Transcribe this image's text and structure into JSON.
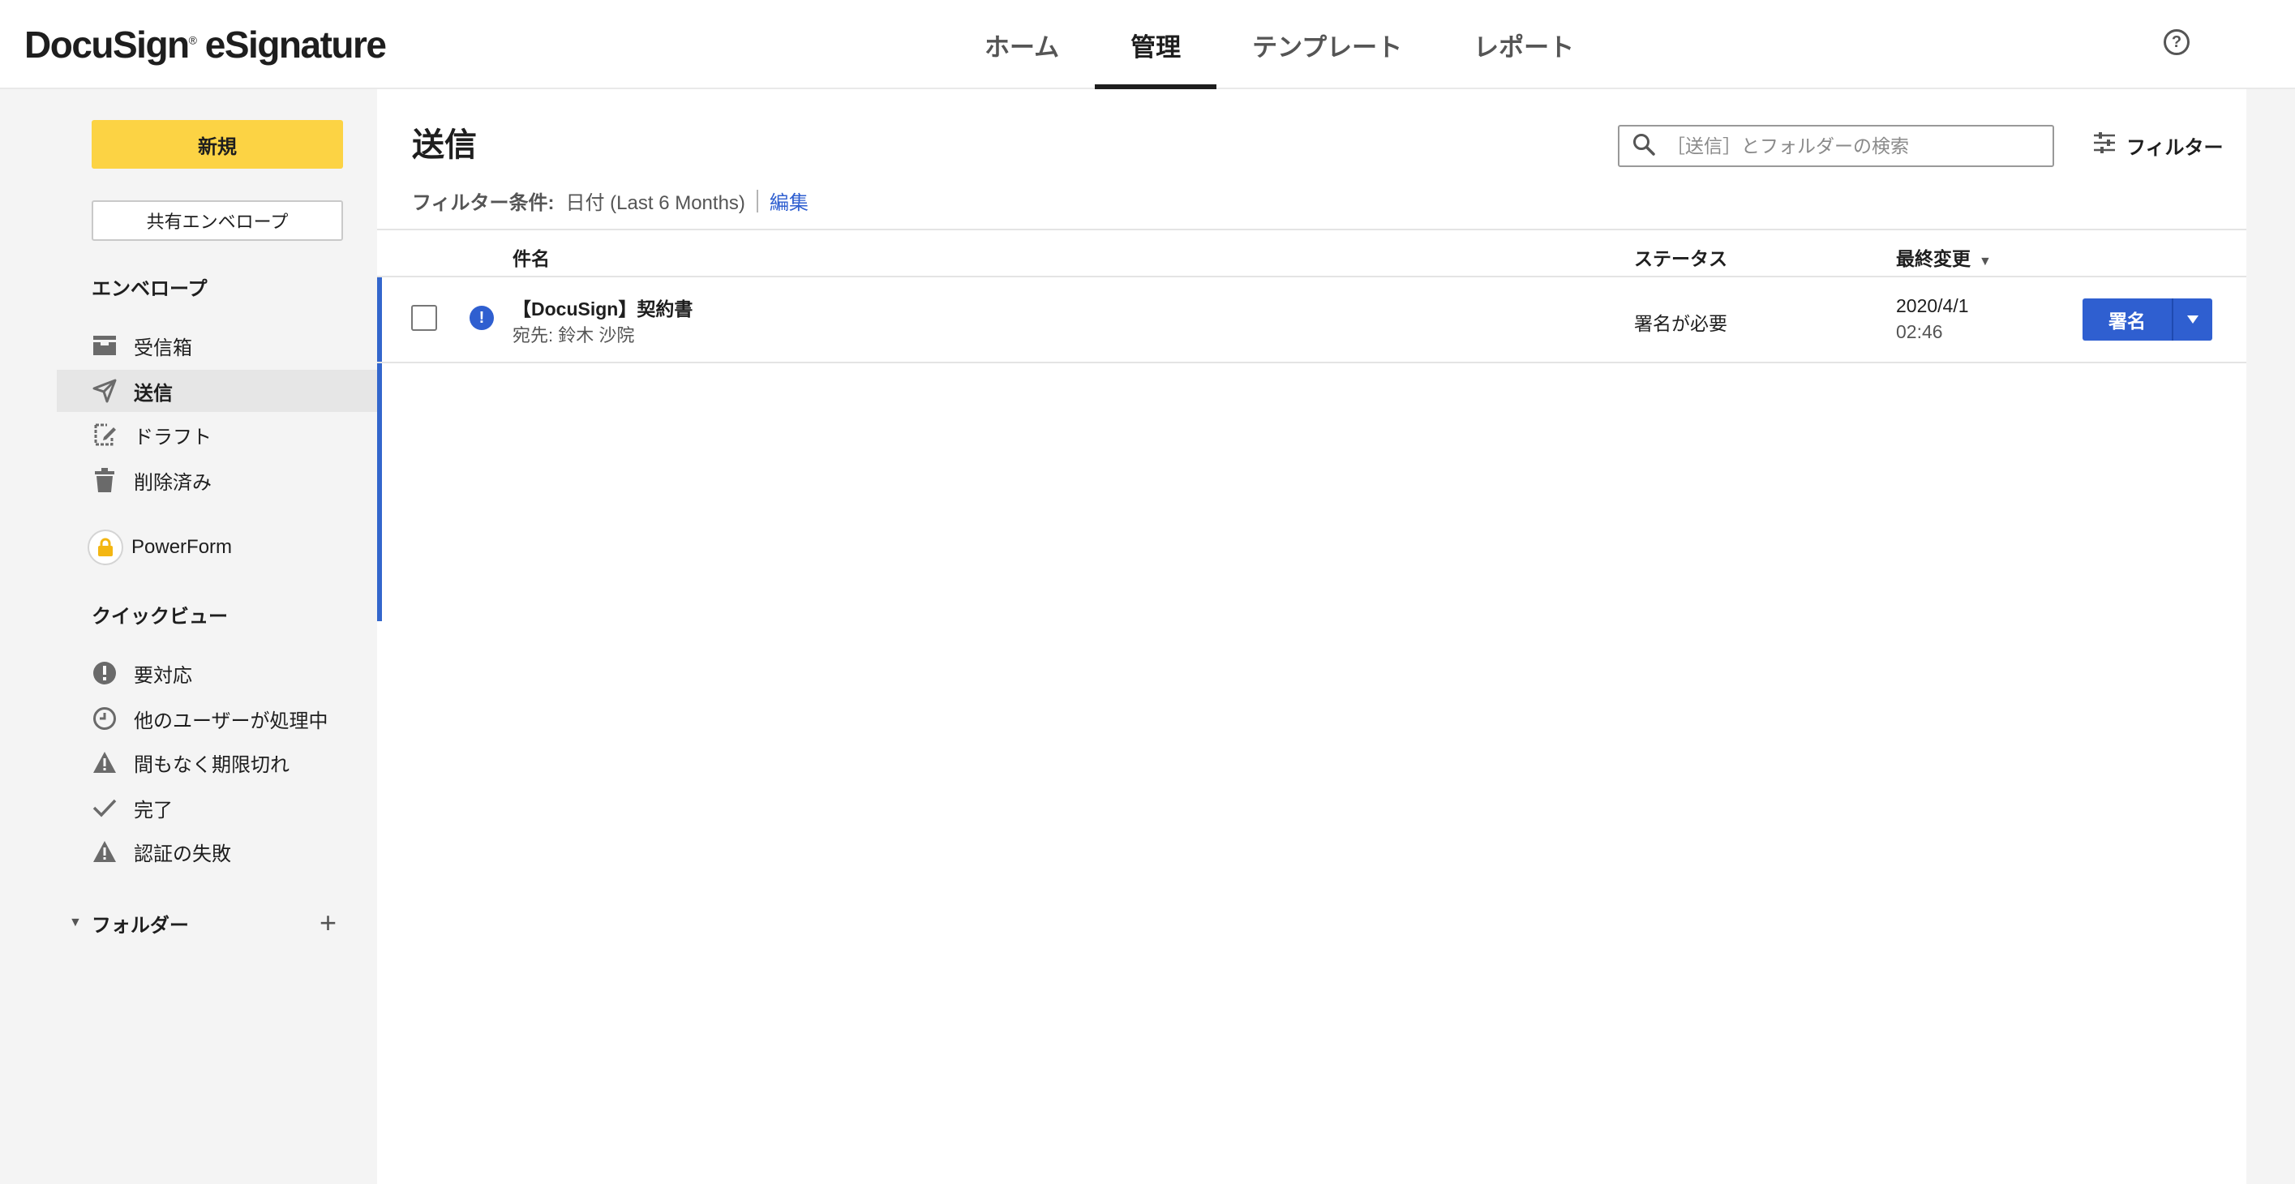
{
  "app": {
    "logo_text": "DocuSign",
    "logo_tm": "®",
    "logo_product": " eSignature"
  },
  "nav": {
    "tabs": [
      {
        "label": "ホーム",
        "active": false
      },
      {
        "label": "管理",
        "active": true
      },
      {
        "label": "テンプレート",
        "active": false
      },
      {
        "label": "レポート",
        "active": false
      }
    ],
    "help_label": "?"
  },
  "sidebar": {
    "new_button": "新規",
    "shared_button": "共有エンベロープ",
    "envelopes_title": "エンベロープ",
    "envelope_items": [
      {
        "label": "受信箱",
        "icon": "inbox-icon",
        "active": false
      },
      {
        "label": "送信",
        "icon": "send-icon",
        "active": true
      },
      {
        "label": "ドラフト",
        "icon": "draft-icon",
        "active": false
      },
      {
        "label": "削除済み",
        "icon": "trash-icon",
        "active": false
      }
    ],
    "powerform_label": "PowerForm",
    "quickview_title": "クイックビュー",
    "quickview_items": [
      {
        "label": "要対応",
        "icon": "alert-circle-icon"
      },
      {
        "label": "他のユーザーが処理中",
        "icon": "clock-icon"
      },
      {
        "label": "間もなく期限切れ",
        "icon": "warning-icon"
      },
      {
        "label": "完了",
        "icon": "check-icon"
      },
      {
        "label": "認証の失敗",
        "icon": "warning-icon"
      }
    ],
    "folders_label": "フォルダー",
    "folders_add": "+"
  },
  "main": {
    "title": "送信",
    "search_placeholder": "［送信］とフォルダーの検索",
    "filter_button": "フィルター",
    "filter_condition_label": "フィルター条件:",
    "filter_condition_value": "日付 (Last 6 Months)",
    "filter_edit": "編集",
    "columns": {
      "subject": "件名",
      "status": "ステータス",
      "last_modified": "最終変更"
    },
    "rows": [
      {
        "subject": "【DocuSign】契約書",
        "recipient": "宛先: 鈴木 沙院",
        "status": "署名が必要",
        "date": "2020/4/1",
        "time": "02:46",
        "action": "署名"
      }
    ]
  },
  "colors": {
    "accent_blue": "#2f5fd0",
    "new_button_yellow": "#fcd344"
  }
}
